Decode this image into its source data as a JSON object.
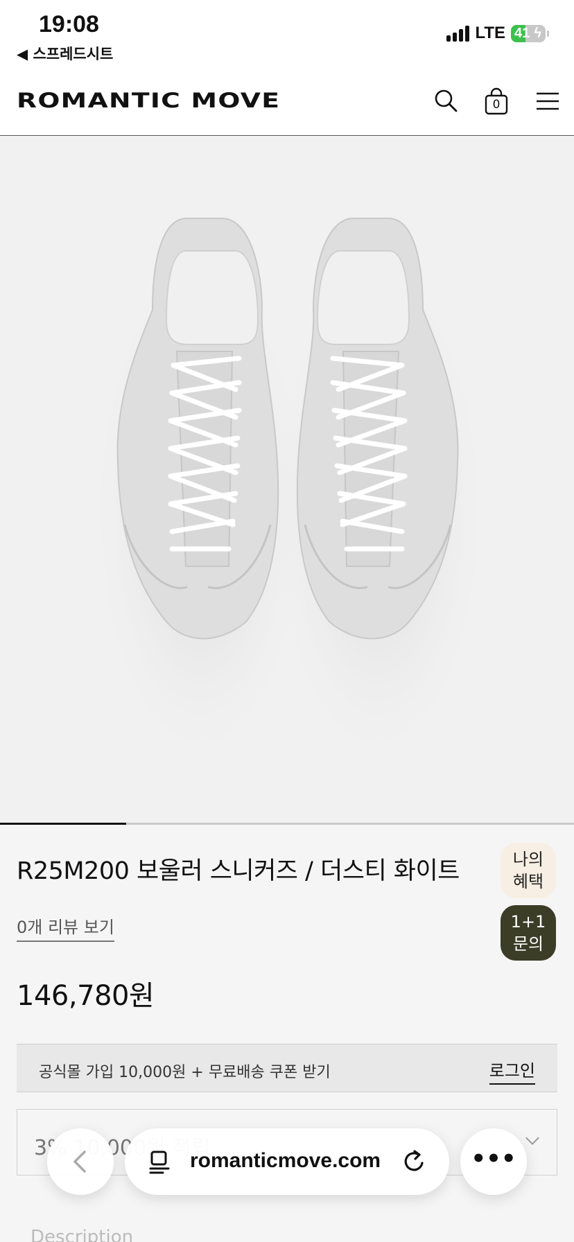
{
  "status_bar": {
    "time": "19:08",
    "back_app": "◀ 스프레드시트",
    "network": "LTE",
    "battery": "41",
    "battery_level": 0.41
  },
  "header": {
    "logo": "ROMANTIC MOVE",
    "cart_count": "0"
  },
  "gallery": {
    "progress": 0.22
  },
  "product": {
    "title": "R25M200 보울러 스니커즈 / 더스티 화이트",
    "review_link": "0개 리뷰 보기",
    "price": "146,780원"
  },
  "side_buttons": {
    "benefit_line1": "나의",
    "benefit_line2": "혜택",
    "qna_line1": "1+1",
    "qna_line2": "문의"
  },
  "coupon": {
    "text": "공식몰 가입 10,000원 + 무료배송 쿠폰 받기",
    "login": "로그인"
  },
  "option_box": {
    "text": "3% 10,000원 적립"
  },
  "below_text": "Description",
  "browser": {
    "url": "romanticmove.com",
    "more": "•••"
  }
}
